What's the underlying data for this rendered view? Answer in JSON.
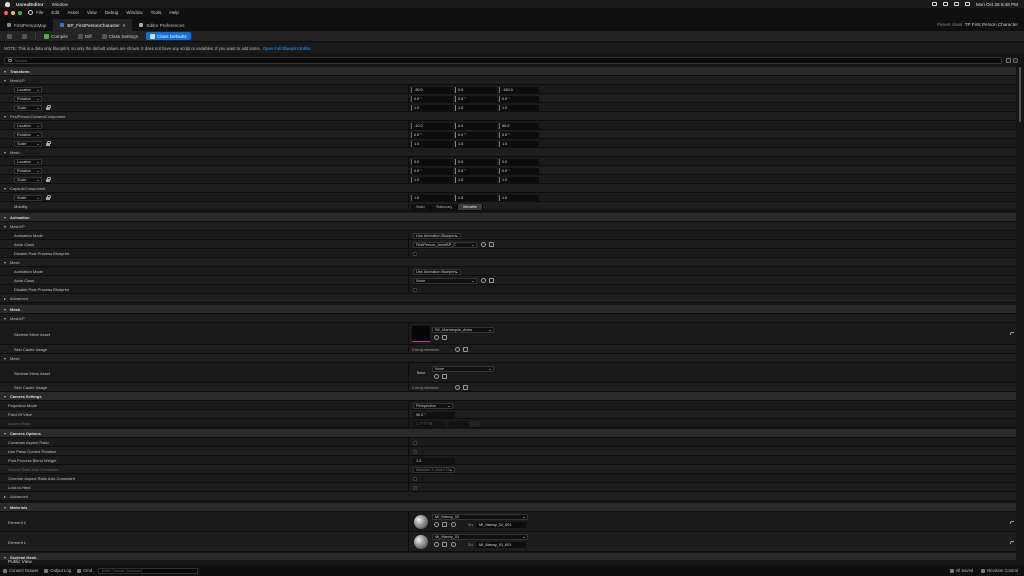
{
  "menubar": {
    "app": "UnrealEditor",
    "items": [
      "Window"
    ],
    "clock": "Mon Oct 28 8:48 PM"
  },
  "titlebar": {
    "items": [
      "File",
      "Edit",
      "Asset",
      "View",
      "Debug",
      "Window",
      "Tools",
      "Help"
    ]
  },
  "tabs": {
    "level": "FirstPersonMap",
    "blueprint": "BP_FirstPersonCharacter",
    "prefs": "Editor Preferences",
    "parent_label": "Parent class:",
    "parent_value": "TP First Person Character"
  },
  "toolbar": {
    "save": "",
    "compile": "Compile",
    "diff": "Diff",
    "class_settings": "Class Settings",
    "class_defaults": "Class Defaults"
  },
  "notice": {
    "text": "NOTE: This is a data only blueprint, so only the default values are shown.  It does not have any script or variables.  If you want to add some,",
    "link": "Open Full Blueprint Editor"
  },
  "search": {
    "placeholder": "Search"
  },
  "details": {
    "transform": "Transform",
    "mesh1p": "Mesh1P",
    "fpcc": "FirstPersonCameraComponent",
    "mesh": "Mesh",
    "capsule": "CapsuleComponent",
    "location": "Location",
    "rotation": "Rotation",
    "scale": "Scale",
    "mobility": "Mobility",
    "m1p_loc": [
      "-30.0",
      "0.0",
      "-150.0"
    ],
    "m1p_rot": [
      "0.0 °",
      "0.0 °",
      "0.0 °"
    ],
    "m1p_scale": [
      "1.0",
      "1.0",
      "1.0"
    ],
    "cam_loc": [
      "-10.0",
      "0.0",
      "60.0"
    ],
    "cam_rot": [
      "0.0 °",
      "0.0 °",
      "0.0 °"
    ],
    "cam_scale": [
      "1.0",
      "1.0",
      "1.0"
    ],
    "mesh_loc": [
      "0.0",
      "0.0",
      "0.0"
    ],
    "mesh_rot": [
      "0.0 °",
      "0.0 °",
      "0.0 °"
    ],
    "mesh_scale": [
      "1.0",
      "1.0",
      "1.0"
    ],
    "cap_scale": [
      "1.0",
      "1.0",
      "1.0"
    ],
    "mobility_opts": [
      "Static",
      "Stationary",
      "Movable"
    ],
    "animation": "Animation",
    "anim_mode": "Animation Mode",
    "anim_class": "Anim Class",
    "disable_pp": "Disable Post Process Blueprint",
    "anim_mode_val": "Use Animation Blueprint",
    "anim_class_val1": "FirstPerson_AnimBP_C",
    "anim_class_val2": "None",
    "advanced": "Advanced",
    "mesh_cat": "Mesh",
    "skel_mesh_asset": "Skeletal Mesh Asset",
    "skin_cache": "Skin Cache Usage",
    "skel_val1": "SK_Mannequin_Arms",
    "skel_val2": "None",
    "thumb_none": "None",
    "array_elems": "0 Array elements",
    "camera_settings": "Camera Settings",
    "projection_mode": "Projection Mode",
    "projection_val": "Perspective",
    "fov": "Field Of View",
    "fov_val": "90.0 °",
    "aspect_ratio": "Aspect Ratio",
    "aspect_val": "1.777778",
    "camera_options": "Camera Options",
    "constrain_aspect": "Constrain Aspect Ratio",
    "use_pawn": "Use Pawn Control Rotation",
    "pp_blend": "Post Process Blend Weight",
    "pp_blend_val": "1.0",
    "aspect_axis": "Aspect Ratio Axis Constraint",
    "aspect_axis_val": "Maintain X-Axis FOV",
    "override_aspect": "Override Aspect Ratio Axis Constraint",
    "lock_hmd": "Lock to Hmd",
    "materials": "Materials",
    "element0": "Element 0",
    "element1": "Element 1",
    "mat0": "MI_Manny_02",
    "mat1": "MI_Manny_01",
    "src": "Src",
    "mat0_src": "MI_Manny_02_001",
    "mat1_src": "MI_Manny_01_001",
    "skeletal_mesh": "Skeletal Mesh"
  },
  "status": {
    "content_drawer": "Content Drawer",
    "output_log": "Output Log",
    "cmd": "Cmd",
    "console_placeholder": "Enter Console Command",
    "all_saved": "All Saved",
    "revision": "Revision Control",
    "public_view": "Public View"
  }
}
